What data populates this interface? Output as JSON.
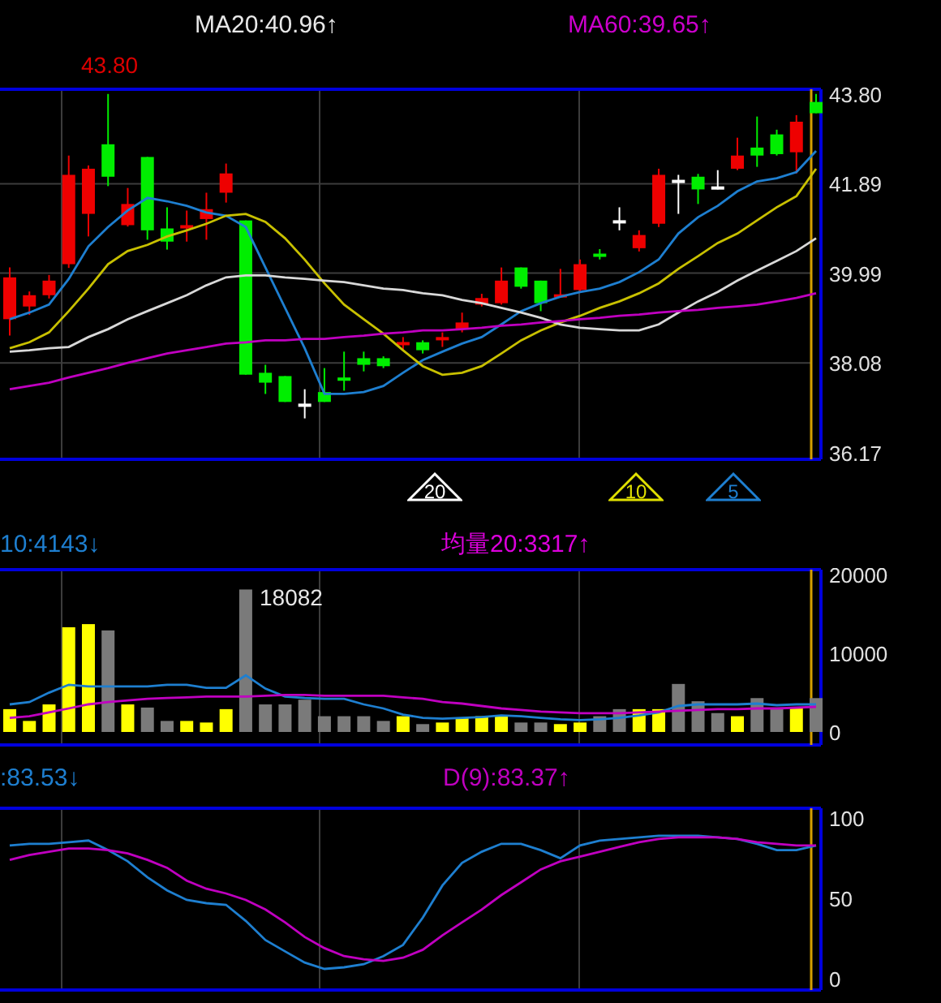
{
  "header": {
    "labels": [
      {
        "text": "MA20:40.96↑",
        "color": "#e8e8e8"
      },
      {
        "text": "MA60:39.65↑",
        "color": "#cc00cc"
      }
    ],
    "peak_label": "43.80"
  },
  "price_panel": {
    "chart_data": {
      "type": "candlestick",
      "ylim": [
        36.03,
        43.9
      ],
      "grid": true,
      "yticks": [
        {
          "value": 43.8,
          "label": "43.80"
        },
        {
          "value": 41.89,
          "label": "41.89"
        },
        {
          "value": 39.99,
          "label": "39.99"
        },
        {
          "value": 38.08,
          "label": "38.08"
        },
        {
          "value": 36.17,
          "label": "36.17"
        }
      ],
      "ohlc": [
        [
          39.01,
          40.11,
          38.66,
          39.9
        ],
        [
          39.28,
          39.6,
          39.1,
          39.52
        ],
        [
          39.52,
          39.95,
          39.45,
          39.83
        ],
        [
          40.18,
          42.49,
          40.1,
          42.08
        ],
        [
          41.25,
          42.28,
          40.77,
          42.21
        ],
        [
          42.73,
          43.8,
          41.84,
          42.04
        ],
        [
          41.01,
          41.8,
          40.98,
          41.46
        ],
        [
          42.46,
          42.46,
          40.7,
          40.9
        ],
        [
          40.94,
          41.39,
          40.49,
          40.66
        ],
        [
          40.94,
          41.32,
          40.66,
          41.01
        ],
        [
          41.14,
          41.7,
          40.7,
          41.35
        ],
        [
          41.7,
          42.32,
          41.49,
          42.11
        ],
        [
          41.11,
          41.11,
          37.83,
          37.83
        ],
        [
          37.87,
          38.04,
          37.42,
          37.66
        ],
        [
          37.8,
          37.8,
          37.25,
          37.25
        ],
        [
          37.18,
          37.52,
          36.9,
          37.18
        ],
        [
          37.46,
          37.97,
          37.25,
          37.25
        ],
        [
          37.77,
          38.32,
          37.49,
          37.7
        ],
        [
          38.18,
          38.32,
          37.9,
          38.04
        ],
        [
          38.18,
          38.22,
          37.97,
          38.01
        ],
        [
          38.46,
          38.63,
          38.35,
          38.52
        ],
        [
          38.52,
          38.56,
          38.28,
          38.35
        ],
        [
          38.56,
          38.73,
          38.42,
          38.63
        ],
        [
          38.8,
          39.15,
          38.73,
          38.94
        ],
        [
          39.32,
          39.55,
          39.28,
          39.46
        ],
        [
          39.35,
          40.11,
          39.32,
          39.83
        ],
        [
          40.11,
          40.11,
          39.66,
          39.7
        ],
        [
          39.83,
          39.83,
          39.18,
          39.35
        ],
        [
          39.49,
          40.08,
          39.49,
          39.52
        ],
        [
          39.63,
          40.28,
          39.6,
          40.18
        ],
        [
          40.39,
          40.5,
          40.28,
          40.35
        ],
        [
          41.08,
          41.39,
          40.9,
          41.08
        ],
        [
          40.52,
          40.9,
          40.45,
          40.8
        ],
        [
          41.04,
          42.21,
          40.97,
          42.08
        ],
        [
          41.94,
          42.08,
          41.25,
          41.94
        ],
        [
          42.04,
          42.1,
          41.46,
          41.77
        ],
        [
          41.8,
          42.18,
          41.77,
          41.8
        ],
        [
          42.21,
          42.87,
          42.18,
          42.49
        ],
        [
          42.66,
          43.32,
          42.25,
          42.49
        ],
        [
          42.94,
          43.04,
          42.49,
          42.52
        ],
        [
          42.56,
          43.35,
          42.11,
          43.21
        ],
        [
          43.63,
          43.8,
          43.39,
          43.39
        ]
      ],
      "series": [
        {
          "type": "line",
          "color": "#1e7fd0",
          "values": [
            39.01,
            39.15,
            39.32,
            39.87,
            40.56,
            40.97,
            41.32,
            41.59,
            41.52,
            41.42,
            41.28,
            41.21,
            40.97,
            40.11,
            39.25,
            38.39,
            37.42,
            37.42,
            37.46,
            37.59,
            37.87,
            38.14,
            38.32,
            38.49,
            38.63,
            38.9,
            39.18,
            39.35,
            39.49,
            39.59,
            39.66,
            39.8,
            40.01,
            40.28,
            40.83,
            41.18,
            41.42,
            41.73,
            41.94,
            42.01,
            42.14,
            42.59
          ]
        },
        {
          "type": "line",
          "color": "#c8c000",
          "values": [
            38.39,
            38.52,
            38.73,
            39.18,
            39.66,
            40.18,
            40.46,
            40.59,
            40.77,
            40.9,
            41.04,
            41.21,
            41.25,
            41.08,
            40.73,
            40.28,
            39.77,
            39.32,
            39.01,
            38.7,
            38.35,
            38.01,
            37.83,
            37.87,
            38.01,
            38.28,
            38.56,
            38.77,
            38.94,
            39.08,
            39.25,
            39.39,
            39.56,
            39.77,
            40.08,
            40.35,
            40.63,
            40.83,
            41.11,
            41.39,
            41.63,
            42.21
          ]
        },
        {
          "type": "line",
          "color": "#d8d8d8",
          "values": [
            38.32,
            38.35,
            38.39,
            38.42,
            38.63,
            38.8,
            39.01,
            39.18,
            39.35,
            39.52,
            39.73,
            39.9,
            39.94,
            39.94,
            39.9,
            39.87,
            39.83,
            39.8,
            39.73,
            39.66,
            39.63,
            39.56,
            39.52,
            39.42,
            39.35,
            39.25,
            39.15,
            39.04,
            38.9,
            38.83,
            38.8,
            38.77,
            38.77,
            38.9,
            39.15,
            39.39,
            39.59,
            39.83,
            40.04,
            40.25,
            40.46,
            40.73
          ]
        },
        {
          "type": "line",
          "color": "#c000c0",
          "values": [
            37.52,
            37.59,
            37.66,
            37.77,
            37.87,
            37.97,
            38.08,
            38.18,
            38.28,
            38.35,
            38.42,
            38.49,
            38.52,
            38.56,
            38.56,
            38.59,
            38.59,
            38.63,
            38.66,
            38.7,
            38.73,
            38.77,
            38.77,
            38.8,
            38.83,
            38.87,
            38.9,
            38.94,
            38.97,
            39.01,
            39.04,
            39.08,
            39.11,
            39.15,
            39.18,
            39.21,
            39.25,
            39.28,
            39.32,
            39.39,
            39.46,
            39.56
          ]
        }
      ]
    }
  },
  "markers": [
    {
      "text": "20",
      "color": "#ffffff"
    },
    {
      "text": "10",
      "color": "#e0e000"
    },
    {
      "text": "5",
      "color": "#1e7fd0"
    }
  ],
  "volume_header": {
    "labels": [
      {
        "text": "10:4143↓",
        "color": "#1e7fd0"
      },
      {
        "text": "均量20:3317↑",
        "color": "#dd00dd"
      }
    ]
  },
  "volume_panel": {
    "peak_label": "18082",
    "chart_data": {
      "type": "bar",
      "ylim": [
        0,
        20000
      ],
      "grid": true,
      "yticks": [
        {
          "value": 20000,
          "label": "20000"
        },
        {
          "value": 10000,
          "label": "10000"
        },
        {
          "value": 0,
          "label": "0"
        }
      ],
      "series": [
        {
          "type": "bar",
          "colors": [
            "#ffff00",
            "#ffff00",
            "#ffff00",
            "#ffff00",
            "#ffff00",
            "#7a7a7a",
            "#ffff00",
            "#7a7a7a",
            "#7a7a7a",
            "#ffff00",
            "#ffff00",
            "#ffff00",
            "#7a7a7a",
            "#7a7a7a",
            "#7a7a7a",
            "#7a7a7a",
            "#7a7a7a",
            "#7a7a7a",
            "#7a7a7a",
            "#7a7a7a",
            "#ffff00",
            "#7a7a7a",
            "#ffff00",
            "#ffff00",
            "#ffff00",
            "#ffff00",
            "#7a7a7a",
            "#7a7a7a",
            "#ffff00",
            "#ffff00",
            "#7a7a7a",
            "#7a7a7a",
            "#ffff00",
            "#ffff00",
            "#7a7a7a",
            "#7a7a7a",
            "#7a7a7a",
            "#ffff00",
            "#7a7a7a",
            "#7a7a7a",
            "#ffff00",
            "#7a7a7a"
          ],
          "values": [
            2900,
            1400,
            3500,
            13300,
            13700,
            12900,
            3500,
            3100,
            1400,
            1400,
            1200,
            2900,
            18100,
            3500,
            3500,
            4100,
            2000,
            2000,
            2000,
            1400,
            2000,
            1000,
            1200,
            1800,
            2000,
            2000,
            1200,
            1200,
            1000,
            1200,
            2000,
            2900,
            2900,
            2900,
            6100,
            3900,
            2400,
            2000,
            4300,
            3100,
            3100,
            4300
          ]
        },
        {
          "type": "line",
          "color": "#1e7fd0",
          "values": [
            3500,
            3800,
            5000,
            6000,
            5800,
            5800,
            5800,
            5800,
            6000,
            6000,
            5600,
            5600,
            7200,
            5500,
            4500,
            4300,
            4200,
            4200,
            3500,
            3000,
            2200,
            1800,
            1700,
            1800,
            1900,
            2100,
            2000,
            1800,
            1600,
            1500,
            1600,
            1800,
            2100,
            2500,
            3300,
            3500,
            3500,
            3500,
            3600,
            3400,
            3500,
            3500
          ]
        },
        {
          "type": "line",
          "color": "#c000c0",
          "values": [
            1800,
            2000,
            2500,
            3000,
            3500,
            3800,
            4000,
            4200,
            4300,
            4400,
            4500,
            4500,
            4500,
            4600,
            4700,
            4700,
            4600,
            4600,
            4600,
            4600,
            4400,
            4200,
            3800,
            3600,
            3300,
            3000,
            2800,
            2600,
            2500,
            2400,
            2400,
            2400,
            2500,
            2600,
            2700,
            2800,
            2900,
            2900,
            3000,
            3000,
            3100,
            3200
          ]
        }
      ]
    }
  },
  "kd_header": {
    "labels": [
      {
        "text": ":83.53↓",
        "color": "#1e7fd0"
      },
      {
        "text": "D(9):83.37↑",
        "color": "#c000c0"
      }
    ]
  },
  "kd_panel": {
    "chart_data": {
      "type": "line",
      "ylim": [
        -7.1,
        106.1
      ],
      "grid": true,
      "yticks": [
        {
          "value": 100,
          "label": "100"
        },
        {
          "value": 50,
          "label": "50"
        },
        {
          "value": 0,
          "label": "0"
        }
      ],
      "series": [
        {
          "color": "#1e7fd0",
          "values": [
            83,
            84,
            84,
            85,
            86,
            80,
            73,
            63,
            55,
            49,
            47,
            46,
            36,
            24,
            17,
            10,
            6,
            7,
            9,
            14,
            21,
            38,
            58,
            72,
            79,
            84,
            84,
            80,
            75,
            83,
            86,
            87,
            88,
            89,
            89,
            89,
            88,
            87,
            84,
            80,
            80,
            83
          ]
        },
        {
          "color": "#c000c0",
          "values": [
            74,
            77,
            79,
            81,
            81,
            80,
            78,
            74,
            69,
            61,
            56,
            53,
            49,
            43,
            35,
            26,
            19,
            14,
            12,
            11,
            13,
            18,
            27,
            35,
            43,
            52,
            60,
            68,
            73,
            76,
            79,
            82,
            85,
            87,
            88,
            88,
            88,
            87,
            85,
            84,
            83,
            83
          ]
        }
      ]
    }
  }
}
